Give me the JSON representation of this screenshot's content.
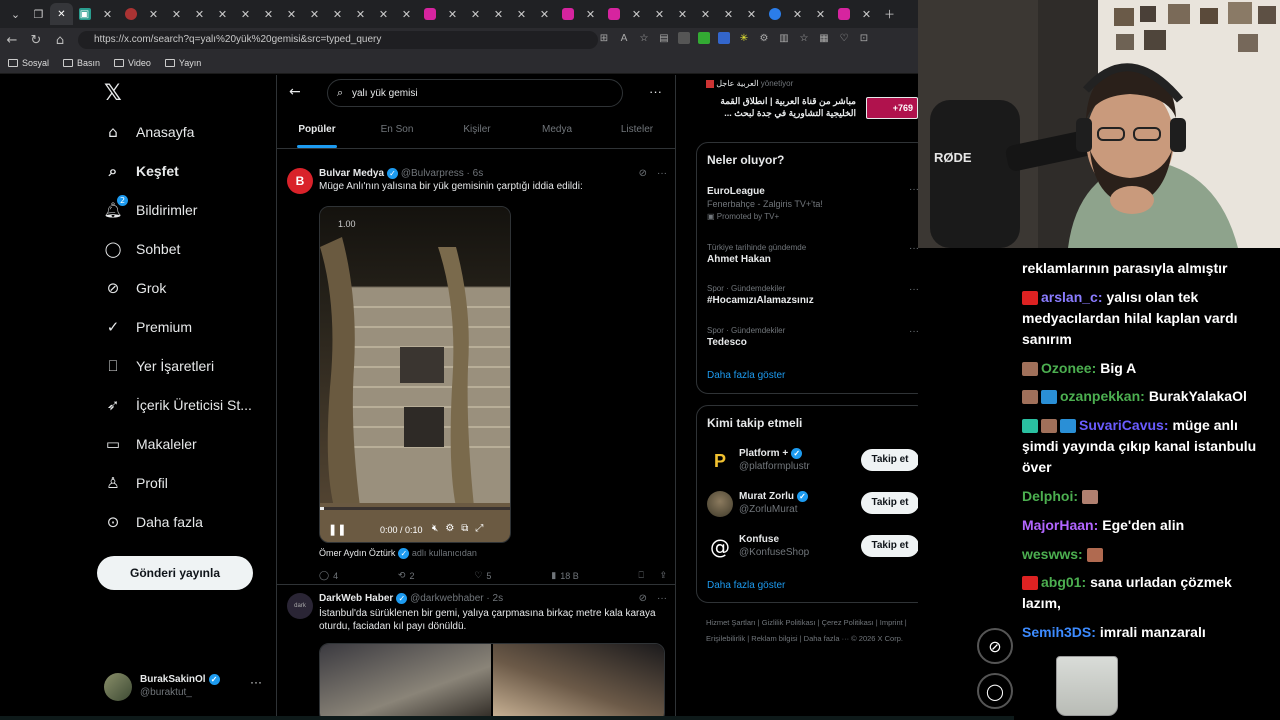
{
  "browser": {
    "url": "https://x.com/search?q=yalı%20yük%20gemisi&src=typed_query",
    "bookmarks": [
      "Sosyal",
      "Basın",
      "Video",
      "Yayın"
    ]
  },
  "nav": {
    "items": [
      "Anasayfa",
      "Keşfet",
      "Bildirimler",
      "Sohbet",
      "Grok",
      "Premium",
      "Yer İşaretleri",
      "İçerik Üreticisi St...",
      "Makaleler",
      "Profil",
      "Daha fazla"
    ],
    "notif_badge": "2",
    "post_button": "Gönderi yayınla",
    "profile_name": "BurakSakinOl",
    "profile_handle": "@buraktut_"
  },
  "search": {
    "query": "yalı yük gemisi",
    "tabs": [
      "Popüler",
      "En Son",
      "Kişiler",
      "Medya",
      "Listeler"
    ]
  },
  "tweets": [
    {
      "name": "Bulvar Medya",
      "handle": "@Bulvarpress",
      "time": "6s",
      "text": "Müge Anlı'nın yalısına bir yük gemisinin çarptığı iddia edildi:",
      "video_overlay": "1.00",
      "video_time": "0:00 / 0:10",
      "tagged": "Ömer Aydın Öztürk",
      "tagged_suffix": "adlı kullanıcıdan",
      "replies": "4",
      "reposts": "2",
      "likes": "5",
      "views": "18 B"
    },
    {
      "name": "DarkWeb Haber",
      "handle": "@darkwebhaber",
      "time": "2s",
      "text": "İstanbul'da sürüklenen bir gemi, yalıya çarpmasına birkaç metre kala karaya oturdu, faciadan kıl payı dönüldü."
    }
  ],
  "right": {
    "top_ad_source": "العربية عاجل",
    "top_ad_meta": "yönetiyor",
    "top_ad_text": "مباشر من قناة العربية | انطلاق القمة الخليجية التشاورية في جدة لبحث ...",
    "top_ad_count": "+769",
    "trends_title": "Neler oluyor?",
    "trends": [
      {
        "meta": "",
        "name": "EuroLeague",
        "sub": "Fenerbahçe - Zalgiris TV+'ta!",
        "promo": "Promoted by TV+"
      },
      {
        "meta": "Türkiye tarihinde gündemde",
        "name": "Ahmet Hakan",
        "sub": "",
        "promo": ""
      },
      {
        "meta": "Spor · Gündemdekiler",
        "name": "#HocamızıAlamazsınız",
        "sub": "",
        "promo": ""
      },
      {
        "meta": "Spor · Gündemdekiler",
        "name": "Tedesco",
        "sub": "",
        "promo": ""
      }
    ],
    "show_more": "Daha fazla göster",
    "follow_title": "Kimi takip etmeli",
    "follow": [
      {
        "name": "Platform +",
        "handle": "@platformplustr"
      },
      {
        "name": "Murat Zorlu",
        "handle": "@ZorluMurat"
      },
      {
        "name": "Konfuse",
        "handle": "@KonfuseShop"
      }
    ],
    "follow_btn": "Takip et",
    "footer": "Hizmet Şartları | Gizlilik Politikası | Çerez Politikası | Imprint | Erişilebilirlik | Reklam bilgisi | Daha fazla ··· © 2026 X Corp."
  },
  "chat": [
    {
      "user": "",
      "text": "reklamlarının parasıyla almıştır",
      "color": "#ffffff"
    },
    {
      "user": "arslan_c:",
      "text": "yalısı olan tek medyacılardan hilal kaplan vardı sanırım",
      "color": "#8a7cff"
    },
    {
      "user": "Ozonee:",
      "text": "Big A",
      "color": "#4caf50"
    },
    {
      "user": "ozanpekkan:",
      "text": "BurakYalakaOl",
      "color": "#4caf50"
    },
    {
      "user": "SuvariCavus:",
      "text": "müge anlı şimdi yayında çıkıp kanal istanbulu över",
      "color": "#6a5cff"
    },
    {
      "user": "Delphoi:",
      "text": "",
      "color": "#4caf50"
    },
    {
      "user": "MajorHaan:",
      "text": "Ege'den alin",
      "color": "#b266ff"
    },
    {
      "user": "weswws:",
      "text": "",
      "color": "#4caf50"
    },
    {
      "user": "abg01:",
      "text": "sana urladan çözmek lazım,",
      "color": "#4caf50"
    },
    {
      "user": "Semih3DS:",
      "text": "imrali manzaralı",
      "color": "#3d8bff"
    }
  ],
  "webcam": {
    "mic_brand": "RØDE"
  },
  "colors": {
    "accent": "#1d9bf0",
    "bg": "#000000",
    "border": "#2f3336",
    "muted": "#71767b"
  }
}
